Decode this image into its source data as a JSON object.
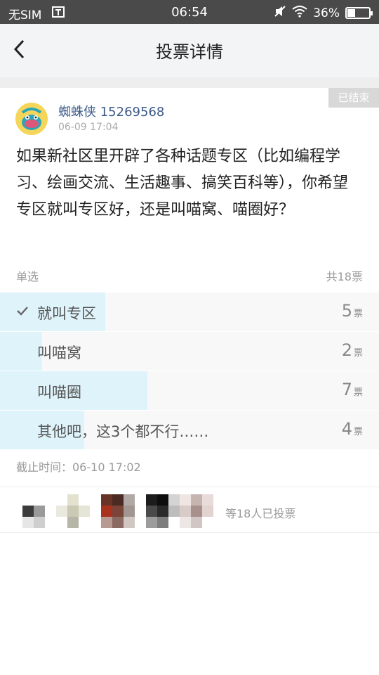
{
  "status_bar": {
    "carrier": "无SIM",
    "time": "06:54",
    "battery": "36%",
    "battery_level": 0.36
  },
  "nav": {
    "title": "投票详情"
  },
  "poll": {
    "status_tag": "已结束",
    "author_name": "蜘蛛侠",
    "author_id": "15269568",
    "post_time": "06-09 17:04",
    "question": "如果新社区里开辟了各种话题专区（比如编程学习、绘画交流、生活趣事、搞笑百科等），你希望专区就叫专区好，还是叫喵窝、喵圈好？",
    "type_label": "单选",
    "total_votes": "共18票",
    "vote_unit": "票",
    "options": [
      {
        "label": "就叫专区",
        "votes": "5",
        "fraction": 0.278,
        "selected": true
      },
      {
        "label": "叫喵窝",
        "votes": "2",
        "fraction": 0.111,
        "selected": false
      },
      {
        "label": "叫喵圈",
        "votes": "7",
        "fraction": 0.389,
        "selected": false
      },
      {
        "label": "其他吧，这3个都不行……",
        "votes": "4",
        "fraction": 0.222,
        "selected": false
      }
    ],
    "deadline": "截止时间：06-10 17:02",
    "voters_text": "等18人已投票"
  },
  "colors": {
    "accent_blue": "#3d5a8a",
    "bar_fill": "#dff3fa",
    "status_bar": "#4a4a4a"
  }
}
